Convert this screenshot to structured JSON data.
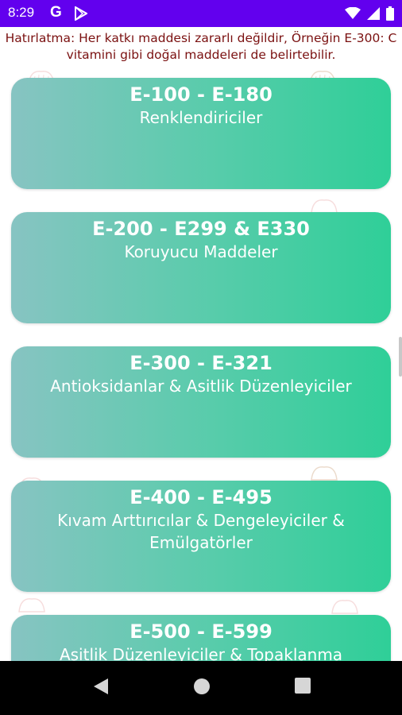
{
  "status_bar": {
    "time": "8:29",
    "g_label": "G",
    "bg_color": "#6200ee"
  },
  "notice": {
    "text": "Hatırlatma: Her katkı maddesi zararlı değildir, Örneğin E-300: C vitamini gibi doğal maddeleri de belirtebilir.",
    "color": "#7a1010"
  },
  "categories": [
    {
      "range": "E-100 - E-180",
      "label": "Renklendiriciler"
    },
    {
      "range": "E-200 - E299 & E330",
      "label": "Koruyucu Maddeler"
    },
    {
      "range": "E-300 - E-321",
      "label": "Antioksidanlar & Asitlik Düzenleyiciler"
    },
    {
      "range": "E-400 - E-495",
      "label": "Kıvam Arttırıcılar & Dengeleyiciler & Emülgatörler"
    },
    {
      "range": "E-500 - E-599",
      "label": "Asitlik Düzenleyiciler & Topaklanma"
    }
  ],
  "card_gradient": [
    "#87c4c2",
    "#2fcf98"
  ],
  "nav_bar": {
    "back_icon": "back-triangle-icon",
    "home_icon": "home-circle-icon",
    "recents_icon": "recents-square-icon"
  }
}
